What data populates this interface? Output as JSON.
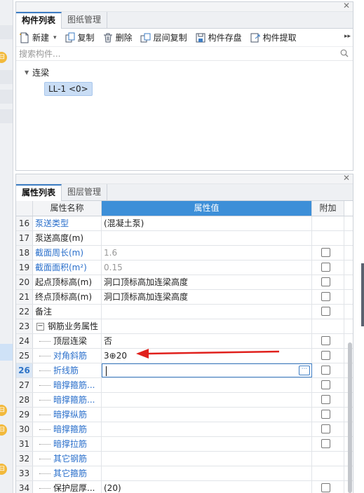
{
  "left_strip": {
    "badges": [
      "⊟",
      "⊟",
      "⊟",
      "⊟"
    ]
  },
  "component_panel": {
    "tabs": [
      "构件列表",
      "图纸管理"
    ],
    "active_tab": 0,
    "toolbar": {
      "new_label": "新建",
      "new_dropdown": "▾",
      "copy_label": "复制",
      "delete_label": "删除",
      "floor_copy_label": "层间复制",
      "save_label": "构件存盘",
      "extract_label": "构件提取",
      "more": "▸▸"
    },
    "search": {
      "placeholder": "搜索构件..."
    },
    "tree": {
      "category": "连梁",
      "item": "LL-1 <0>"
    }
  },
  "property_panel": {
    "tabs": [
      "属性列表",
      "图层管理"
    ],
    "active_tab": 0,
    "columns": {
      "name": "属性名称",
      "value": "属性值",
      "extra": "附加"
    },
    "rows": [
      {
        "num": "16",
        "name": "泵送类型",
        "value": "(混凝土泵)",
        "blue": true,
        "gray": false,
        "checkbox": false,
        "indent": false,
        "group": false
      },
      {
        "num": "17",
        "name": "泵送高度(m)",
        "value": "",
        "blue": false,
        "gray": false,
        "checkbox": false,
        "indent": false,
        "group": false
      },
      {
        "num": "18",
        "name": "截面周长(m)",
        "value": "1.6",
        "blue": true,
        "gray": true,
        "checkbox": true,
        "indent": false,
        "group": false
      },
      {
        "num": "19",
        "name": "截面面积(m²)",
        "value": "0.15",
        "blue": true,
        "gray": true,
        "checkbox": true,
        "indent": false,
        "group": false
      },
      {
        "num": "20",
        "name": "起点顶标高(m)",
        "value": "洞口顶标高加连梁高度",
        "blue": false,
        "gray": false,
        "checkbox": true,
        "indent": false,
        "group": false
      },
      {
        "num": "21",
        "name": "终点顶标高(m)",
        "value": "洞口顶标高加连梁高度",
        "blue": false,
        "gray": false,
        "checkbox": true,
        "indent": false,
        "group": false
      },
      {
        "num": "22",
        "name": "备注",
        "value": "",
        "blue": false,
        "gray": false,
        "checkbox": true,
        "indent": false,
        "group": false
      },
      {
        "num": "23",
        "name": "钢筋业务属性",
        "value": "",
        "blue": false,
        "gray": false,
        "checkbox": false,
        "indent": false,
        "group": true
      },
      {
        "num": "24",
        "name": "顶层连梁",
        "value": "否",
        "blue": false,
        "gray": false,
        "checkbox": true,
        "indent": true,
        "group": false
      },
      {
        "num": "25",
        "name": "对角斜筋",
        "value": "3⊕20",
        "blue": true,
        "gray": false,
        "checkbox": true,
        "indent": true,
        "group": false
      },
      {
        "num": "26",
        "name": "折线筋",
        "value": "",
        "blue": true,
        "gray": false,
        "checkbox": true,
        "indent": true,
        "group": false,
        "editing": true,
        "active": true
      },
      {
        "num": "27",
        "name": "暗撑箍筋...",
        "value": "",
        "blue": true,
        "gray": false,
        "checkbox": true,
        "indent": true,
        "group": false
      },
      {
        "num": "28",
        "name": "暗撑箍筋...",
        "value": "",
        "blue": true,
        "gray": false,
        "checkbox": true,
        "indent": true,
        "group": false
      },
      {
        "num": "29",
        "name": "暗撑纵筋",
        "value": "",
        "blue": true,
        "gray": false,
        "checkbox": true,
        "indent": true,
        "group": false
      },
      {
        "num": "30",
        "name": "暗撑箍筋",
        "value": "",
        "blue": true,
        "gray": false,
        "checkbox": true,
        "indent": true,
        "group": false
      },
      {
        "num": "31",
        "name": "暗撑拉筋",
        "value": "",
        "blue": true,
        "gray": false,
        "checkbox": true,
        "indent": true,
        "group": false
      },
      {
        "num": "32",
        "name": "其它钢筋",
        "value": "",
        "blue": true,
        "gray": false,
        "checkbox": false,
        "indent": true,
        "group": false
      },
      {
        "num": "33",
        "name": "其它箍筋",
        "value": "",
        "blue": true,
        "gray": false,
        "checkbox": false,
        "indent": true,
        "group": false
      },
      {
        "num": "34",
        "name": "保护层厚...",
        "value": "(20)",
        "blue": false,
        "gray": false,
        "checkbox": true,
        "indent": true,
        "group": false
      }
    ],
    "editor_button": "···"
  },
  "colors": {
    "header_value_bg": "#3d8fd8",
    "link_blue": "#2a6fcb",
    "annotation_arrow": "#e0201c"
  }
}
